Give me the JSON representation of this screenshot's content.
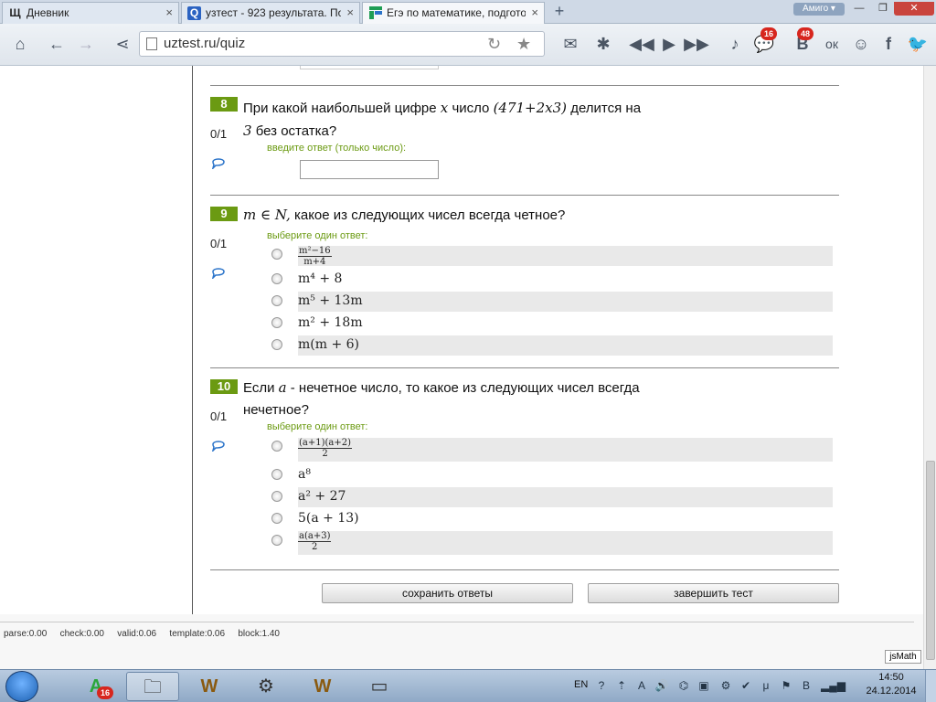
{
  "tabs": [
    {
      "title": "Дневник",
      "favicon": "Щ",
      "close": "×"
    },
    {
      "title": "узтест - 923 результата. Пои",
      "favicon": "Q",
      "close": "×"
    },
    {
      "title": "Егэ по математике, подгото",
      "favicon": "",
      "close": "×"
    }
  ],
  "new_tab": "+",
  "user_menu": "Амиго ▾",
  "window_controls": {
    "minimize": "—",
    "maximize": "❐",
    "close": "✕"
  },
  "toolbar": {
    "url": "uztest.ru/quiz",
    "social_badges": {
      "messages": "16",
      "vk": "48"
    },
    "vk_letter": "B",
    "ok_letter": "ок",
    "fb_letter": "f"
  },
  "questions": [
    {
      "number": "8",
      "text_line1_before": "При какой наибольшей цифре",
      "text_var": "x",
      "text_line1_mid": "число",
      "text_math": "(471+2x3)",
      "text_line1_after": "делится на",
      "text_line2_math": "3",
      "text_line2": "без остатка?",
      "score": "0/1",
      "hint": "введите ответ (только число):",
      "answer_value": ""
    },
    {
      "number": "9",
      "text_math": "m ∈ N,",
      "text": "какое из следующих чисел всегда четное?",
      "score": "0/1",
      "hint": "выберите один ответ:",
      "options": [
        {
          "num": "m²−16",
          "den": "m+4"
        },
        {
          "text": "m⁴ + 8"
        },
        {
          "text": "m⁵ + 13m"
        },
        {
          "text": "m² + 18m"
        },
        {
          "text": "m(m + 6)"
        }
      ]
    },
    {
      "number": "10",
      "text_before": "Если",
      "text_var": "a",
      "text_after": "- нечетное число, то какое из следующих чисел всегда",
      "text_line2": "нечетное?",
      "score": "0/1",
      "hint": "выберите один ответ:",
      "options": [
        {
          "num": "(a+1)(a+2)",
          "den": "2"
        },
        {
          "text": "a⁸"
        },
        {
          "text": "a² + 27"
        },
        {
          "text": "5(a + 13)"
        },
        {
          "num": "a(a+3)",
          "den": "2"
        }
      ]
    }
  ],
  "buttons": {
    "save": "сохранить ответы",
    "finish": "завершить тест"
  },
  "debug": "parse:0.00   check:0.00   valid:0.06   template:0.06   block:1.40",
  "jsmath": "jsMath",
  "taskbar": {
    "apps_badge": "16",
    "lang": "EN",
    "time": "14:50",
    "date": "24.12.2014",
    "vk_tray": "B"
  }
}
